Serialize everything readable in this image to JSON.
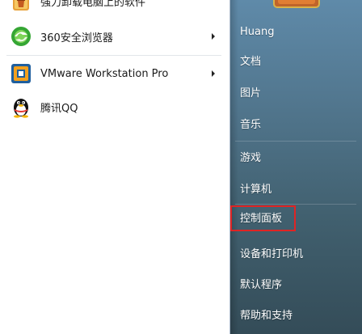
{
  "left_items": [
    {
      "label": "强力卸载电脑上的软件",
      "icon": "uninstaller-icon",
      "has_submenu": false
    },
    {
      "label": "360安全浏览器",
      "icon": "browser-360-icon",
      "has_submenu": true
    },
    {
      "label": "VMware Workstation Pro",
      "icon": "vmware-icon",
      "has_submenu": true
    },
    {
      "label": "腾讯QQ",
      "icon": "qq-penguin-icon",
      "has_submenu": false
    }
  ],
  "right_items": [
    {
      "label": "Huang"
    },
    {
      "label": "文档"
    },
    {
      "label": "图片"
    },
    {
      "label": "音乐"
    },
    {
      "label": "游戏"
    },
    {
      "label": "计算机"
    },
    {
      "label": "控制面板",
      "highlighted": true
    },
    {
      "label": "设备和打印机"
    },
    {
      "label": "默认程序"
    },
    {
      "label": "帮助和支持"
    }
  ],
  "colors": {
    "highlight_border": "#e02424",
    "right_pane_top": "#5f8aa9",
    "right_pane_bottom": "#344c58"
  }
}
